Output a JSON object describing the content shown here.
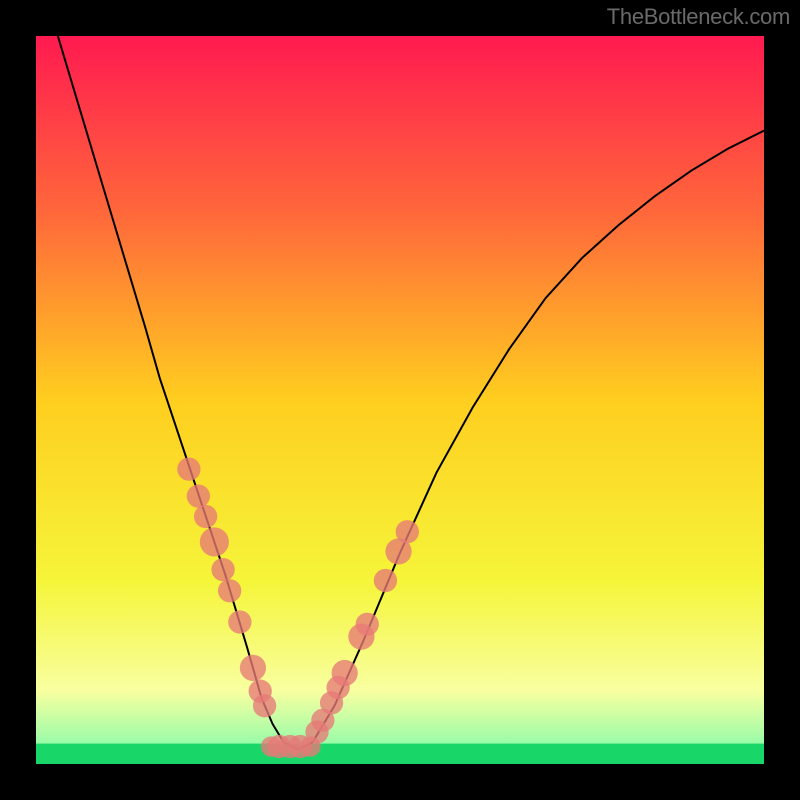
{
  "watermark": "TheBottleneck.com",
  "chart_data": {
    "type": "line",
    "title": "",
    "xlabel": "",
    "ylabel": "",
    "xlim": [
      0,
      100
    ],
    "ylim": [
      0,
      100
    ],
    "series": [
      {
        "name": "curve",
        "x": [
          3,
          6,
          9,
          12,
          15,
          17,
          19,
          21,
          23,
          24.5,
          26,
          27.5,
          29,
          30,
          31,
          32.5,
          34,
          36,
          38,
          41,
          45,
          50,
          55,
          60,
          65,
          70,
          75,
          80,
          85,
          90,
          95,
          100
        ],
        "y": [
          100,
          90,
          80,
          70,
          60,
          53,
          47,
          41,
          35,
          30.5,
          26,
          21,
          16,
          12.5,
          9,
          5.5,
          3,
          2,
          3,
          8,
          17,
          29,
          40,
          49,
          57,
          64,
          69.5,
          74,
          78,
          81.5,
          84.5,
          87
        ]
      }
    ],
    "markers": [
      {
        "x": 21.0,
        "y": 40.5,
        "r": 1.6
      },
      {
        "x": 22.3,
        "y": 36.8,
        "r": 1.6
      },
      {
        "x": 23.3,
        "y": 34.0,
        "r": 1.6
      },
      {
        "x": 24.5,
        "y": 30.5,
        "r": 2.0
      },
      {
        "x": 25.7,
        "y": 26.7,
        "r": 1.6
      },
      {
        "x": 26.6,
        "y": 23.8,
        "r": 1.6
      },
      {
        "x": 28.0,
        "y": 19.5,
        "r": 1.6
      },
      {
        "x": 29.8,
        "y": 13.2,
        "r": 1.8
      },
      {
        "x": 30.8,
        "y": 10.0,
        "r": 1.6
      },
      {
        "x": 31.4,
        "y": 8.0,
        "r": 1.6
      },
      {
        "x": 32.3,
        "y": 2.4,
        "r": 1.4
      },
      {
        "x": 33.4,
        "y": 2.4,
        "r": 1.6
      },
      {
        "x": 34.9,
        "y": 2.4,
        "r": 1.6
      },
      {
        "x": 36.3,
        "y": 2.4,
        "r": 1.6
      },
      {
        "x": 37.7,
        "y": 2.4,
        "r": 1.4
      },
      {
        "x": 38.6,
        "y": 4.4,
        "r": 1.6
      },
      {
        "x": 39.4,
        "y": 6.0,
        "r": 1.6
      },
      {
        "x": 40.6,
        "y": 8.4,
        "r": 1.6
      },
      {
        "x": 41.5,
        "y": 10.5,
        "r": 1.6
      },
      {
        "x": 42.4,
        "y": 12.5,
        "r": 1.8
      },
      {
        "x": 44.7,
        "y": 17.5,
        "r": 1.8
      },
      {
        "x": 45.5,
        "y": 19.2,
        "r": 1.6
      },
      {
        "x": 48.0,
        "y": 25.2,
        "r": 1.6
      },
      {
        "x": 49.8,
        "y": 29.2,
        "r": 1.8
      },
      {
        "x": 51.0,
        "y": 31.9,
        "r": 1.6
      }
    ],
    "gradient": {
      "stops": [
        {
          "offset": 0.0,
          "color": "#ff1a50"
        },
        {
          "offset": 0.25,
          "color": "#ff6a3a"
        },
        {
          "offset": 0.5,
          "color": "#ffce1f"
        },
        {
          "offset": 0.75,
          "color": "#f5f53a"
        },
        {
          "offset": 0.9,
          "color": "#f8ffa0"
        },
        {
          "offset": 0.97,
          "color": "#9cfca8"
        },
        {
          "offset": 1.0,
          "color": "#16e06b"
        }
      ]
    },
    "green_band": {
      "y_top": 97.2,
      "y_bottom": 100
    },
    "curve_color": "#000000",
    "marker_color": "#e77a77"
  }
}
